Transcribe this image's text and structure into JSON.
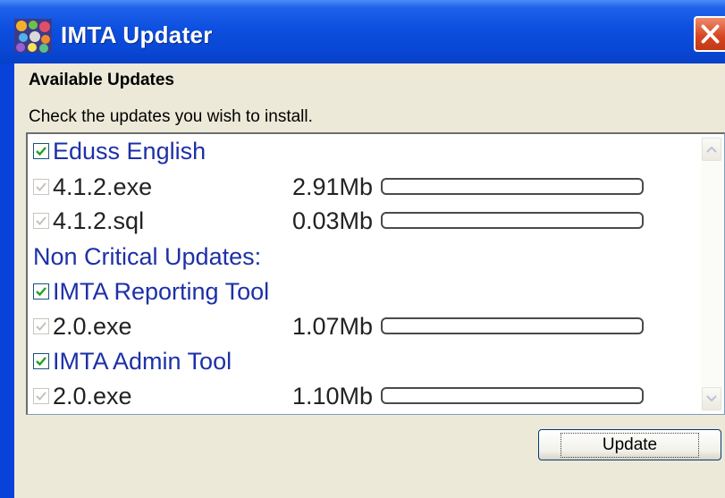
{
  "window": {
    "title": "IMTA Updater",
    "app_icon": "colorful-grid-icon",
    "close_icon": "close-icon"
  },
  "section": {
    "heading": "Available Updates",
    "instruction": "Check the updates you wish to install."
  },
  "groups": [
    {
      "label": "Eduss English",
      "checked": true,
      "files": [
        {
          "name": "4.1.2.exe",
          "size": "2.91Mb",
          "progress": 0
        },
        {
          "name": "4.1.2.sql",
          "size": "0.03Mb",
          "progress": 0
        }
      ]
    },
    {
      "section_label": "Non Critical Updates:"
    },
    {
      "label": "IMTA Reporting Tool",
      "checked": true,
      "files": [
        {
          "name": "2.0.exe",
          "size": "1.07Mb",
          "progress": 0
        }
      ]
    },
    {
      "label": "IMTA Admin Tool",
      "checked": true,
      "files": [
        {
          "name": "2.0.exe",
          "size": "1.10Mb",
          "progress": 0
        }
      ]
    }
  ],
  "buttons": {
    "update": "Update"
  },
  "colors": {
    "titlebar": "#0a48d6",
    "client_bg": "#ece9d8",
    "list_text": "#1d30a8"
  }
}
